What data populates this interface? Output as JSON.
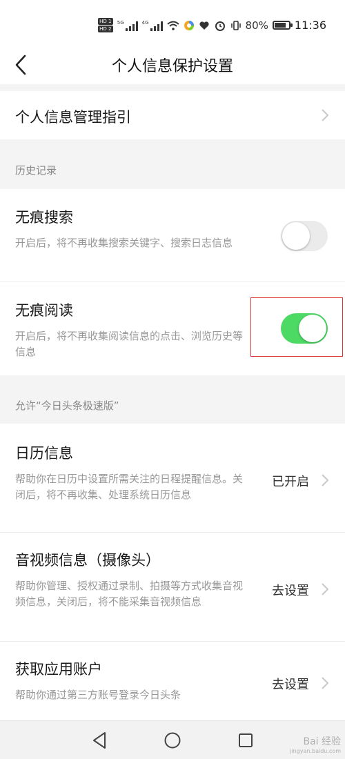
{
  "status_bar": {
    "hd1": "HD 1",
    "hd2": "HD 2",
    "net1": "5G",
    "net2": "4G",
    "battery_percent": "80%",
    "battery_level": 0.8,
    "time": "11:36"
  },
  "header": {
    "title": "个人信息保护设置"
  },
  "guide": {
    "title": "个人信息管理指引"
  },
  "history": {
    "section_label": "历史记录",
    "items": [
      {
        "title": "无痕搜索",
        "desc": "开启后，将不再收集搜索关键字、搜索日志信息",
        "toggle_on": false
      },
      {
        "title": "无痕阅读",
        "desc": "开启后，将不再收集阅读信息的点击、浏览历史等信息",
        "toggle_on": true
      }
    ]
  },
  "permissions": {
    "section_label": "允许“今日头条极速版”",
    "items": [
      {
        "title": "日历信息",
        "desc": "帮助你在日历中设置所需关注的日程提醒信息。关闭后，将不再收集、处理系统日历信息",
        "value": "已开启"
      },
      {
        "title": "音视频信息（摄像头）",
        "desc": "帮助你管理、授权通过录制、拍摄等方式收集音视频信息，关闭后，将不能采集音视频信息",
        "value": "去设置"
      },
      {
        "title": "获取应用账户",
        "desc": "帮助你通过第三方账号登录今日头条",
        "value": "去设置"
      }
    ]
  },
  "watermark": {
    "text": "Bai 经验",
    "sub": "jingyan.baidu.com"
  },
  "colors": {
    "toggle_on": "#4cd964",
    "toggle_off": "#ebebeb",
    "highlight": "#dd3333"
  }
}
